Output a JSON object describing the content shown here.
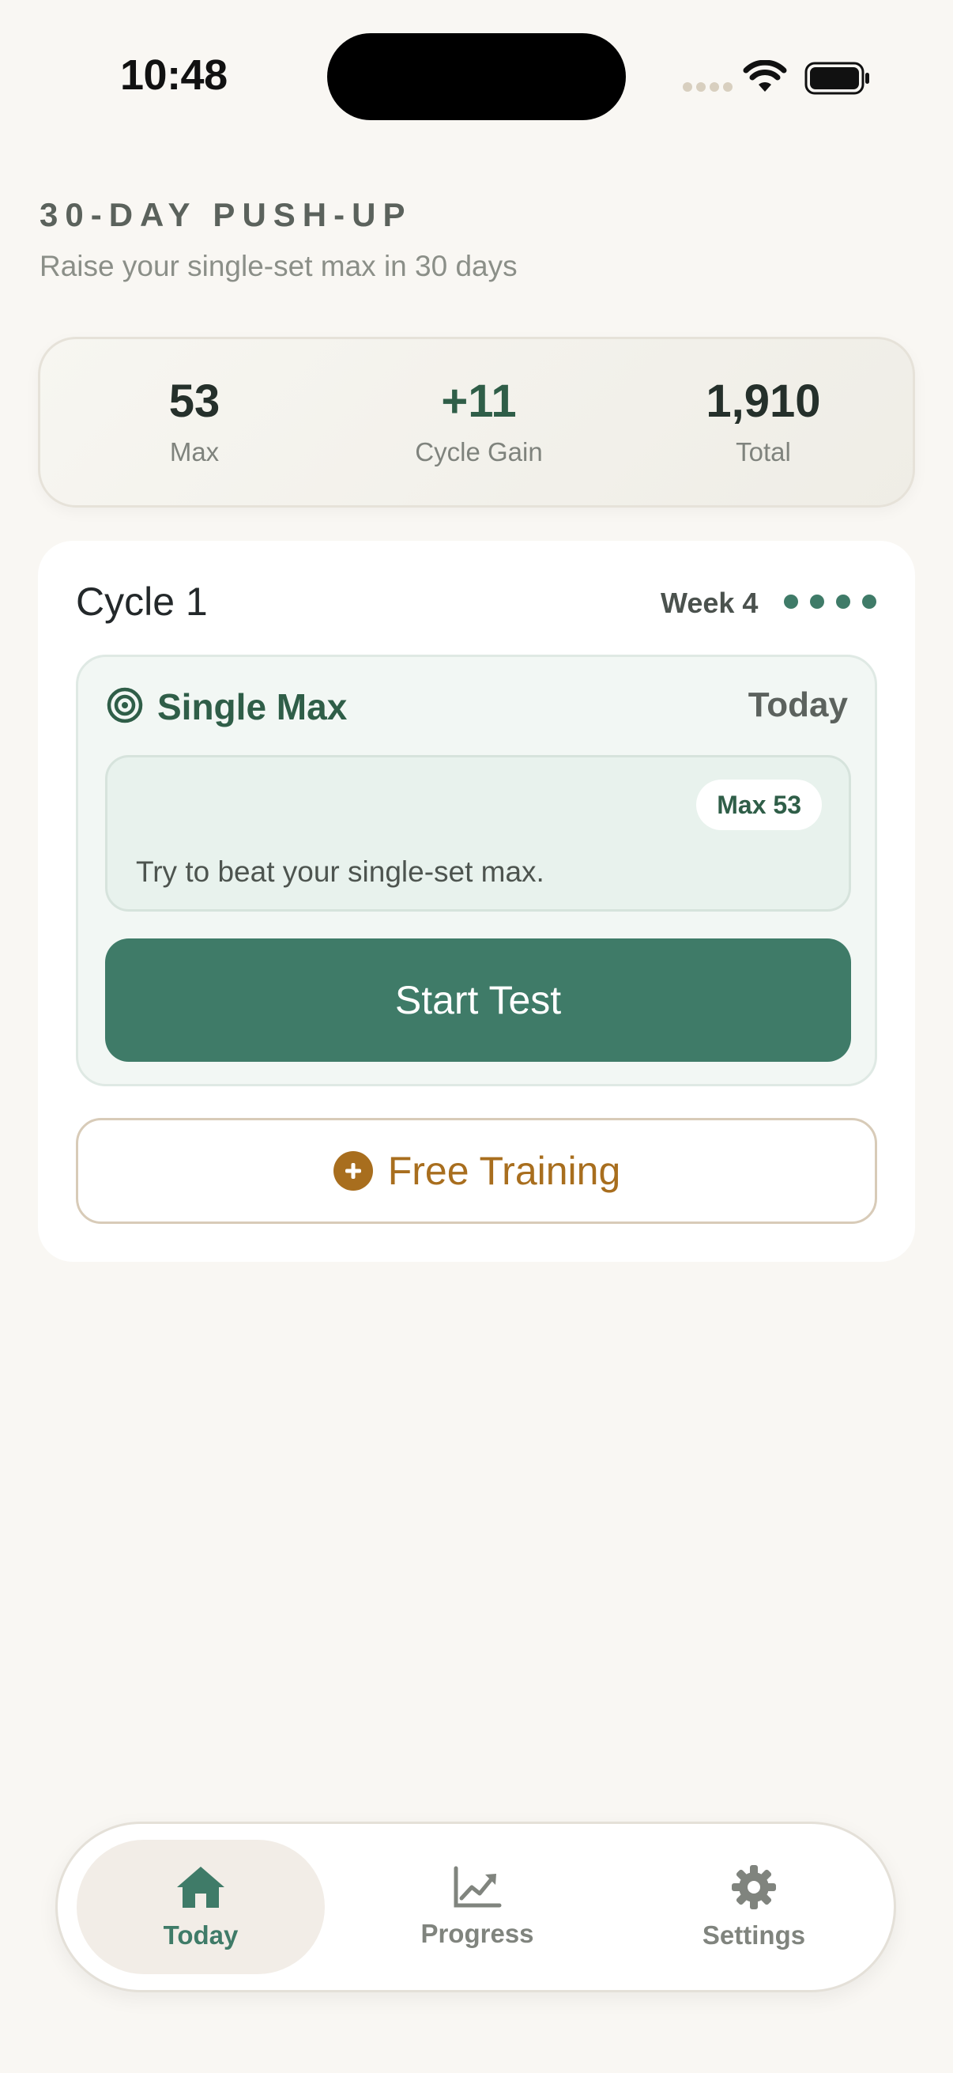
{
  "status_bar": {
    "time": "10:48"
  },
  "header": {
    "title": "30-DAY PUSH-UP",
    "subtitle": "Raise your single-set max in 30 days"
  },
  "stats": [
    {
      "value": "53",
      "label": "Max"
    },
    {
      "value": "+11",
      "label": "Cycle Gain"
    },
    {
      "value": "1,910",
      "label": "Total"
    }
  ],
  "cycle": {
    "title": "Cycle 1",
    "week_label": "Week 4",
    "week_dots_filled": 4,
    "session": {
      "icon": "target-icon",
      "name": "Single Max",
      "when": "Today",
      "max_badge": "Max 53",
      "description": "Try to beat your single-set max.",
      "action_label": "Start Test"
    },
    "free_training": {
      "icon": "plus-circle-icon",
      "label": "Free Training"
    }
  },
  "tabs": [
    {
      "label": "Today",
      "icon": "home-icon",
      "active": true
    },
    {
      "label": "Progress",
      "icon": "chart-icon",
      "active": false
    },
    {
      "label": "Settings",
      "icon": "gear-icon",
      "active": false
    }
  ],
  "colors": {
    "accent_green": "#3f7b68",
    "dark_green_text": "#2f5e48",
    "amber": "#a86e1e",
    "background": "#f9f7f3"
  }
}
